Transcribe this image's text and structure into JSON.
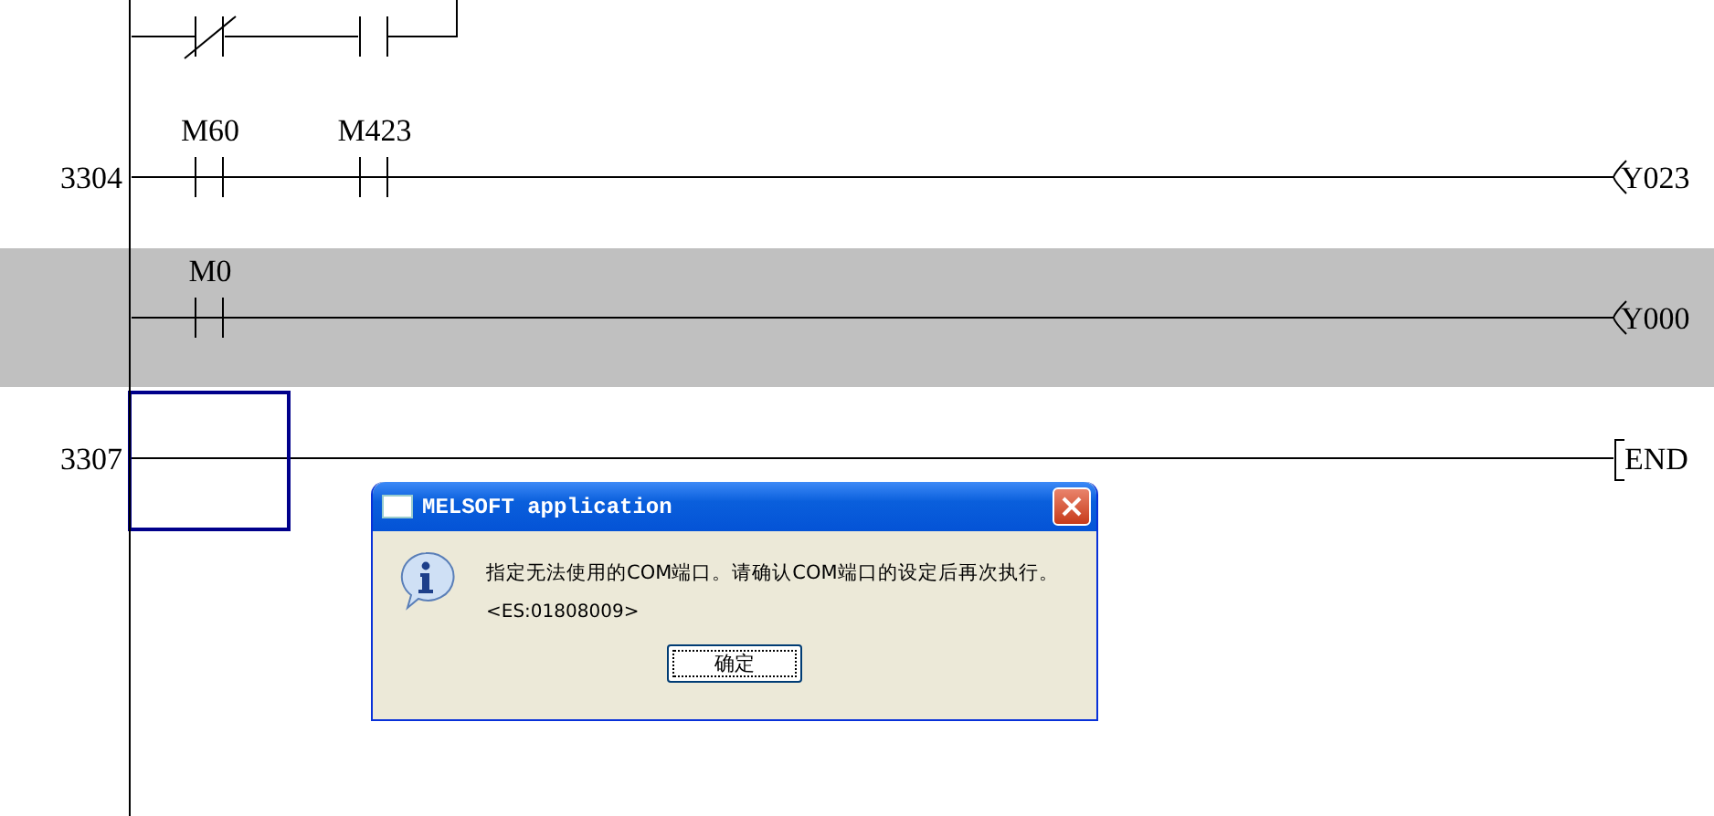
{
  "rungs": [
    {
      "contacts": [
        {
          "kind": "nc"
        },
        {
          "kind": "no"
        }
      ],
      "output": {
        "kind": "branch"
      },
      "selected": false,
      "cursor": false
    },
    {
      "step": "3304",
      "contacts": [
        {
          "kind": "no",
          "label": "M60"
        },
        {
          "kind": "no",
          "label": "M423"
        }
      ],
      "output": {
        "kind": "coil",
        "label": "Y023"
      },
      "selected": false,
      "cursor": false
    },
    {
      "contacts": [
        {
          "kind": "no",
          "label": "M0"
        }
      ],
      "output": {
        "kind": "coil",
        "label": "Y000"
      },
      "selected": true,
      "cursor": false
    },
    {
      "step": "3307",
      "output": {
        "kind": "end",
        "label": "END"
      },
      "selected": false,
      "cursor": true
    }
  ],
  "dialog": {
    "title": "MELSOFT application",
    "message": "指定无法使用的COM端口。请确认COM端口的设定后再次执行。",
    "code": "<ES:01808009>",
    "buttons": [
      "确定"
    ]
  }
}
